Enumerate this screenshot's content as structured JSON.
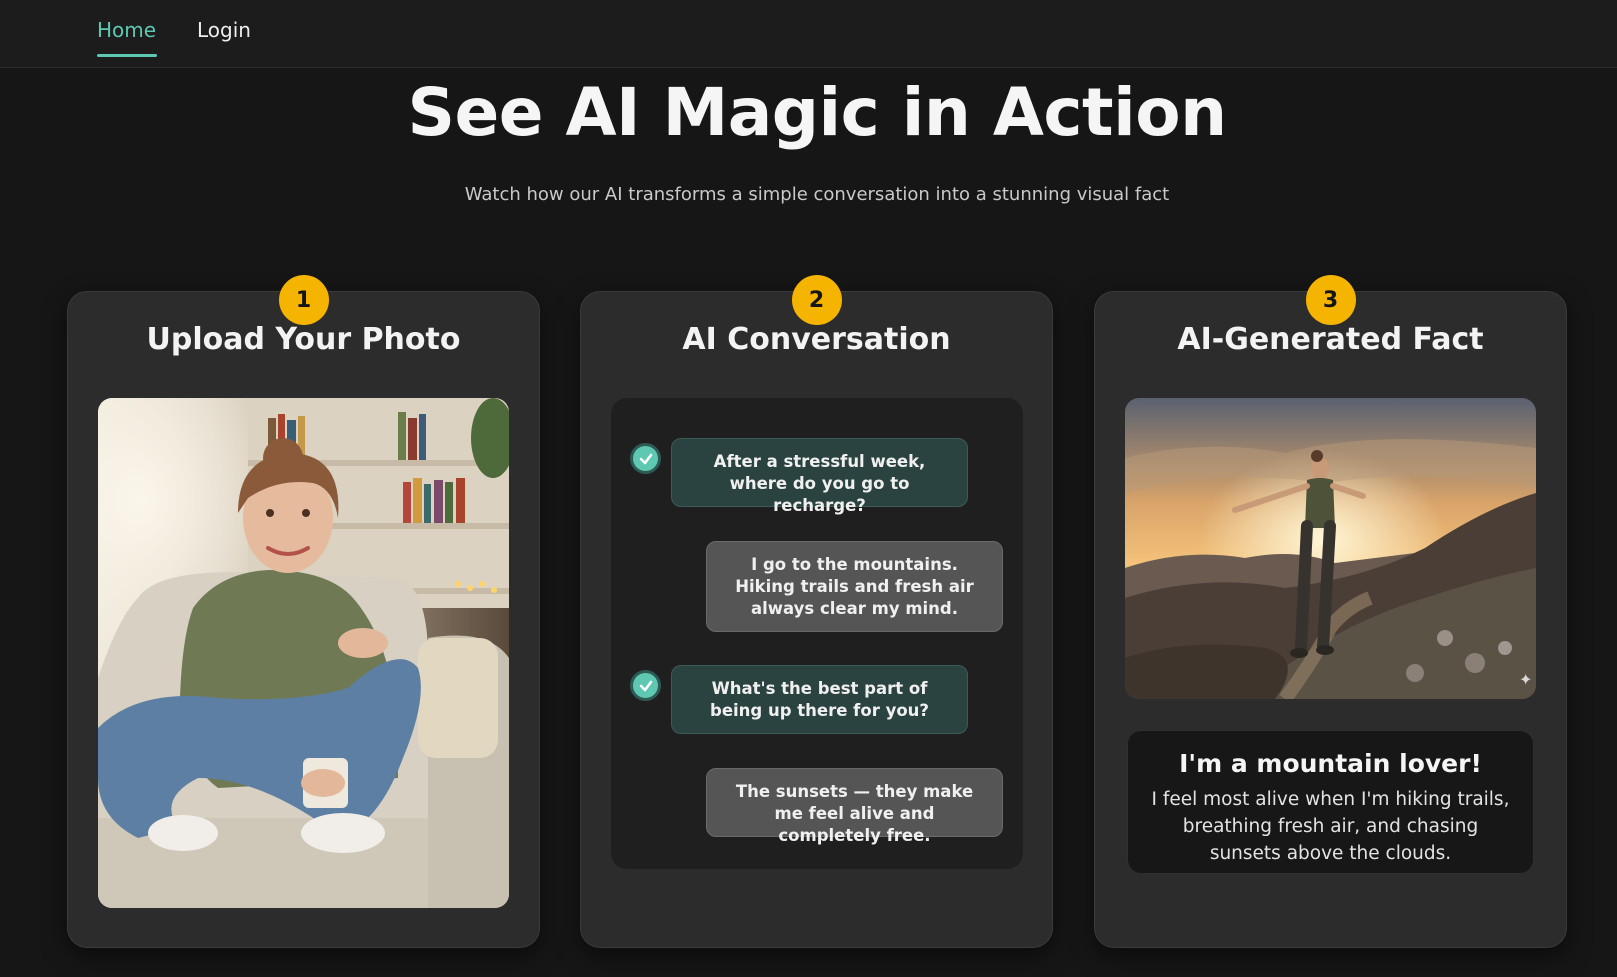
{
  "nav": {
    "items": [
      {
        "label": "Home",
        "active": true
      },
      {
        "label": "Login",
        "active": false
      }
    ],
    "accent_color": "#5ec8b2"
  },
  "hero": {
    "title": "See AI Magic in Action",
    "subtitle": "Watch how our AI transforms a simple conversation into a stunning visual fact"
  },
  "steps": [
    {
      "number": "1",
      "title": "Upload Your Photo"
    },
    {
      "number": "2",
      "title": "AI Conversation"
    },
    {
      "number": "3",
      "title": "AI-Generated Fact"
    }
  ],
  "conversation": [
    {
      "role": "ai",
      "text": "After a stressful week, where do you go to recharge?"
    },
    {
      "role": "user",
      "text": "I go to the mountains. Hiking trails and fresh air always clear my mind."
    },
    {
      "role": "ai",
      "text": "What's the best part of being up there for you?"
    },
    {
      "role": "user",
      "text": "The sunsets — they make me feel alive and completely free."
    }
  ],
  "fact": {
    "title": "I'm a mountain lover!",
    "text": "I feel most alive when I'm hiking trails, breathing fresh air, and chasing sunsets above the clouds."
  },
  "colors": {
    "badge": "#f5b400",
    "ai_bubble": "#2b4340",
    "user_bubble": "#555555"
  }
}
